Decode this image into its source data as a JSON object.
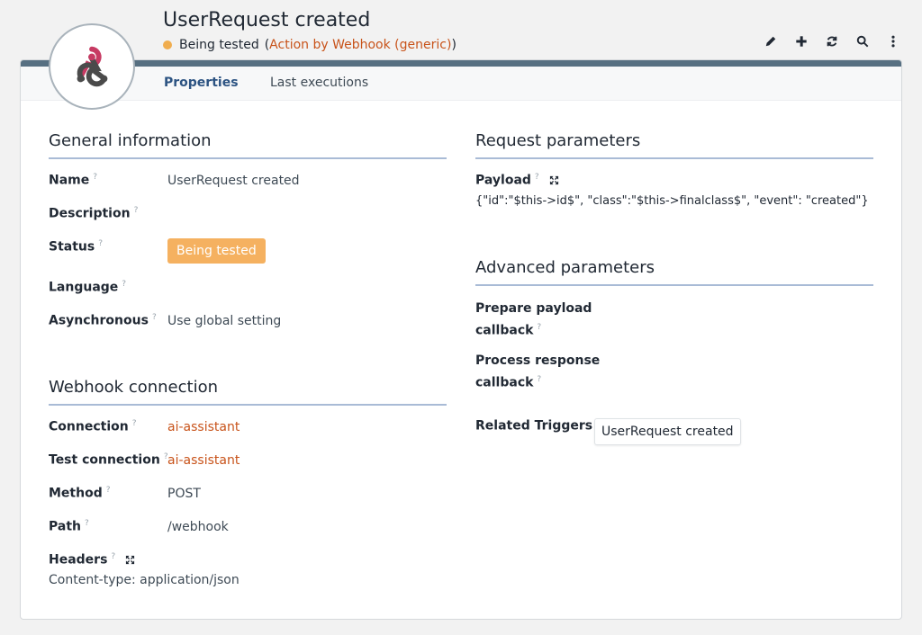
{
  "header": {
    "title": "UserRequest created",
    "status": "Being tested",
    "paren_open": "(",
    "action_link": "Action by Webhook (generic)",
    "paren_close": ")",
    "state_color": "#f0ad4e"
  },
  "toolbar": {
    "icons": [
      "pencil-icon",
      "plus-icon",
      "refresh-icon",
      "search-icon",
      "more-vertical-icon"
    ]
  },
  "tabs": [
    {
      "label": "Properties",
      "active": true
    },
    {
      "label": "Last executions",
      "active": false
    }
  ],
  "general": {
    "title": "General information",
    "q": "?",
    "name_label": "Name",
    "name_value": "UserRequest created",
    "description_label": "Description",
    "status_label": "Status",
    "status_value": "Being tested",
    "language_label": "Language",
    "async_label": "Asynchronous",
    "async_value": "Use global setting"
  },
  "webhook": {
    "title": "Webhook connection",
    "connection_label": "Connection",
    "connection_value": "ai-assistant",
    "test_label": "Test connection",
    "test_value": "ai-assistant",
    "method_label": "Method",
    "method_value": "POST",
    "path_label": "Path",
    "path_value": "/webhook",
    "headers_label": "Headers",
    "headers_value": "Content-type: application/json"
  },
  "request": {
    "title": "Request parameters",
    "payload_label": "Payload",
    "payload_value": "{\"id\":\"$this->id$\", \"class\":\"$this->finalclass$\", \"event\": \"created\"}"
  },
  "advanced": {
    "title": "Advanced parameters",
    "prepare_label_1": "Prepare payload",
    "prepare_label_2": "callback",
    "process_label_1": "Process response",
    "process_label_2": "callback",
    "triggers_label": "Related Triggers",
    "trigger_value": "UserRequest created"
  },
  "colors": {
    "accent": "#2c5382",
    "link": "#c8531a",
    "badge": "#f5b160",
    "topbar": "#577082"
  }
}
